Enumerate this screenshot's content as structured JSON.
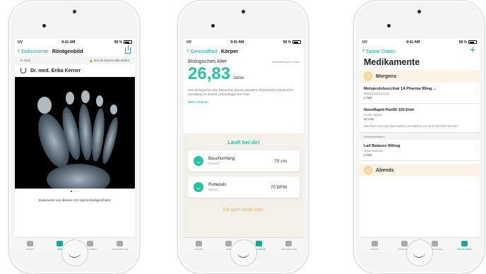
{
  "status": {
    "carrier": "UV",
    "time": "9:41 AM",
    "battery": "58 %"
  },
  "screen1": {
    "back_label": "Dokumente",
    "title": "Röntgenbild",
    "date": "9. JULI",
    "visibility": "Nur du kannst das sehen",
    "doctor": "Dr. med. Erika Kerner",
    "caption": "Dokumente von deinem Arzt sind schreibgeschützt.",
    "tabs": [
      "Aktuell",
      "Akte",
      "Gesundheit",
      "Versicherung"
    ],
    "active_tab": "Akte"
  },
  "screen2": {
    "back_label": "Gesundheit",
    "title": "Körper",
    "bio_label": "Biologisches Alter",
    "updated": "Aktualisiert am 8. März",
    "bio_value": "26,83",
    "bio_unit": "Jahre",
    "description": "Das biologische Alter betrachtet deinen aktuellen körperlichen Zustand im Verhältnis zu deinem chronologischen Alter.",
    "more": "Mehr erfahren",
    "good_heading": "Läuft bei dir!",
    "metrics": [
      {
        "title": "Bauchumfang",
        "status": "Gesund",
        "value": "70 cm"
      },
      {
        "title": "Ruhepuls",
        "status": "Normal",
        "value": "70 BPM"
      }
    ],
    "improve_heading": "Da geht noch was.",
    "tabs": [
      "Aktuell",
      "Akte",
      "Gesundheit",
      "Versicherung"
    ],
    "active_tab": "Gesundheit"
  },
  "screen3": {
    "back_label": "Deine Daten",
    "title": "Medikamente",
    "morning": "Morgens",
    "meds": [
      {
        "name": "Metoprololsuccinat 1A Pharma 95mg ...",
        "substance": "Metoprololsuccinat",
        "dose": "1 Tabl"
      },
      {
        "name": "NovoRapid Penfill 100 E/ml",
        "substance": "Insulin aspart",
        "dose": "20 Amp",
        "note": "Wechseln der Injecktionsstellen unmittelbar vor einer Mahlzeit spritzen."
      }
    ],
    "self_med": "Selbstmedikation",
    "self_meds": [
      {
        "name": "Laif Balance 900mg",
        "substance": "Johanniskraut",
        "dose": "1 Tabl"
      }
    ],
    "evening": "Abends",
    "tabs": [
      "Aktuell",
      "Gesundheit",
      "Versicherung",
      "Deine Daten"
    ],
    "active_tab": "Deine Daten"
  },
  "colors": {
    "accent": "#19a89a",
    "green": "#27c3a0",
    "warn": "#f0b23c"
  }
}
